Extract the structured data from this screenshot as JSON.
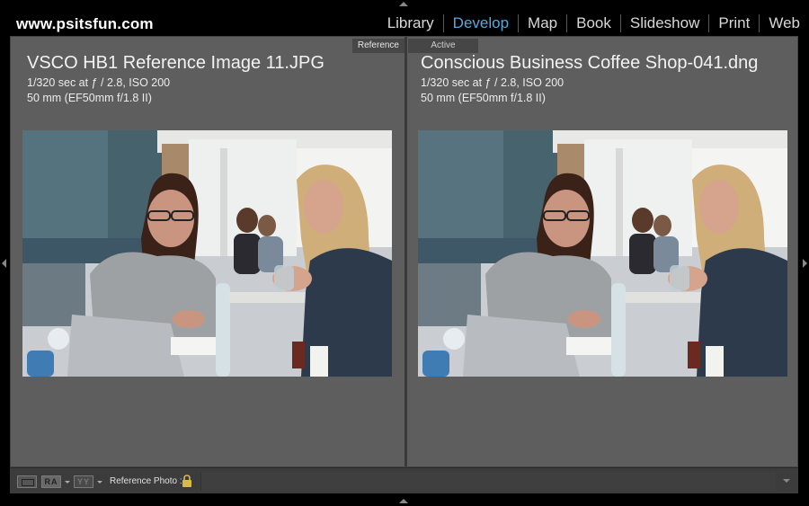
{
  "brand": "www.psitsfun.com",
  "modules": [
    {
      "label": "Library",
      "active": false
    },
    {
      "label": "Develop",
      "active": true
    },
    {
      "label": "Map",
      "active": false
    },
    {
      "label": "Book",
      "active": false
    },
    {
      "label": "Slideshow",
      "active": false
    },
    {
      "label": "Print",
      "active": false
    },
    {
      "label": "Web",
      "active": false
    }
  ],
  "left_pane": {
    "tag": "Reference",
    "filename": "VSCO HB1 Reference Image 11.JPG",
    "exposure": "1/320 sec at ƒ / 2.8, ISO 200",
    "lens": "50 mm (EF50mm f/1.8 II)"
  },
  "right_pane": {
    "tag": "Active",
    "filename": "Conscious Business Coffee Shop-041.dng",
    "exposure": "1/320 sec at ƒ / 2.8, ISO 200",
    "lens": "50 mm (EF50mm f/1.8 II)"
  },
  "toolbar": {
    "ra_label": "RA",
    "yy_label": "YY",
    "reference_label": "Reference Photo :"
  },
  "colors": {
    "accent": "#5aa9dc",
    "panel": "#5e5e5e",
    "toolbar": "#3c3c3c"
  }
}
